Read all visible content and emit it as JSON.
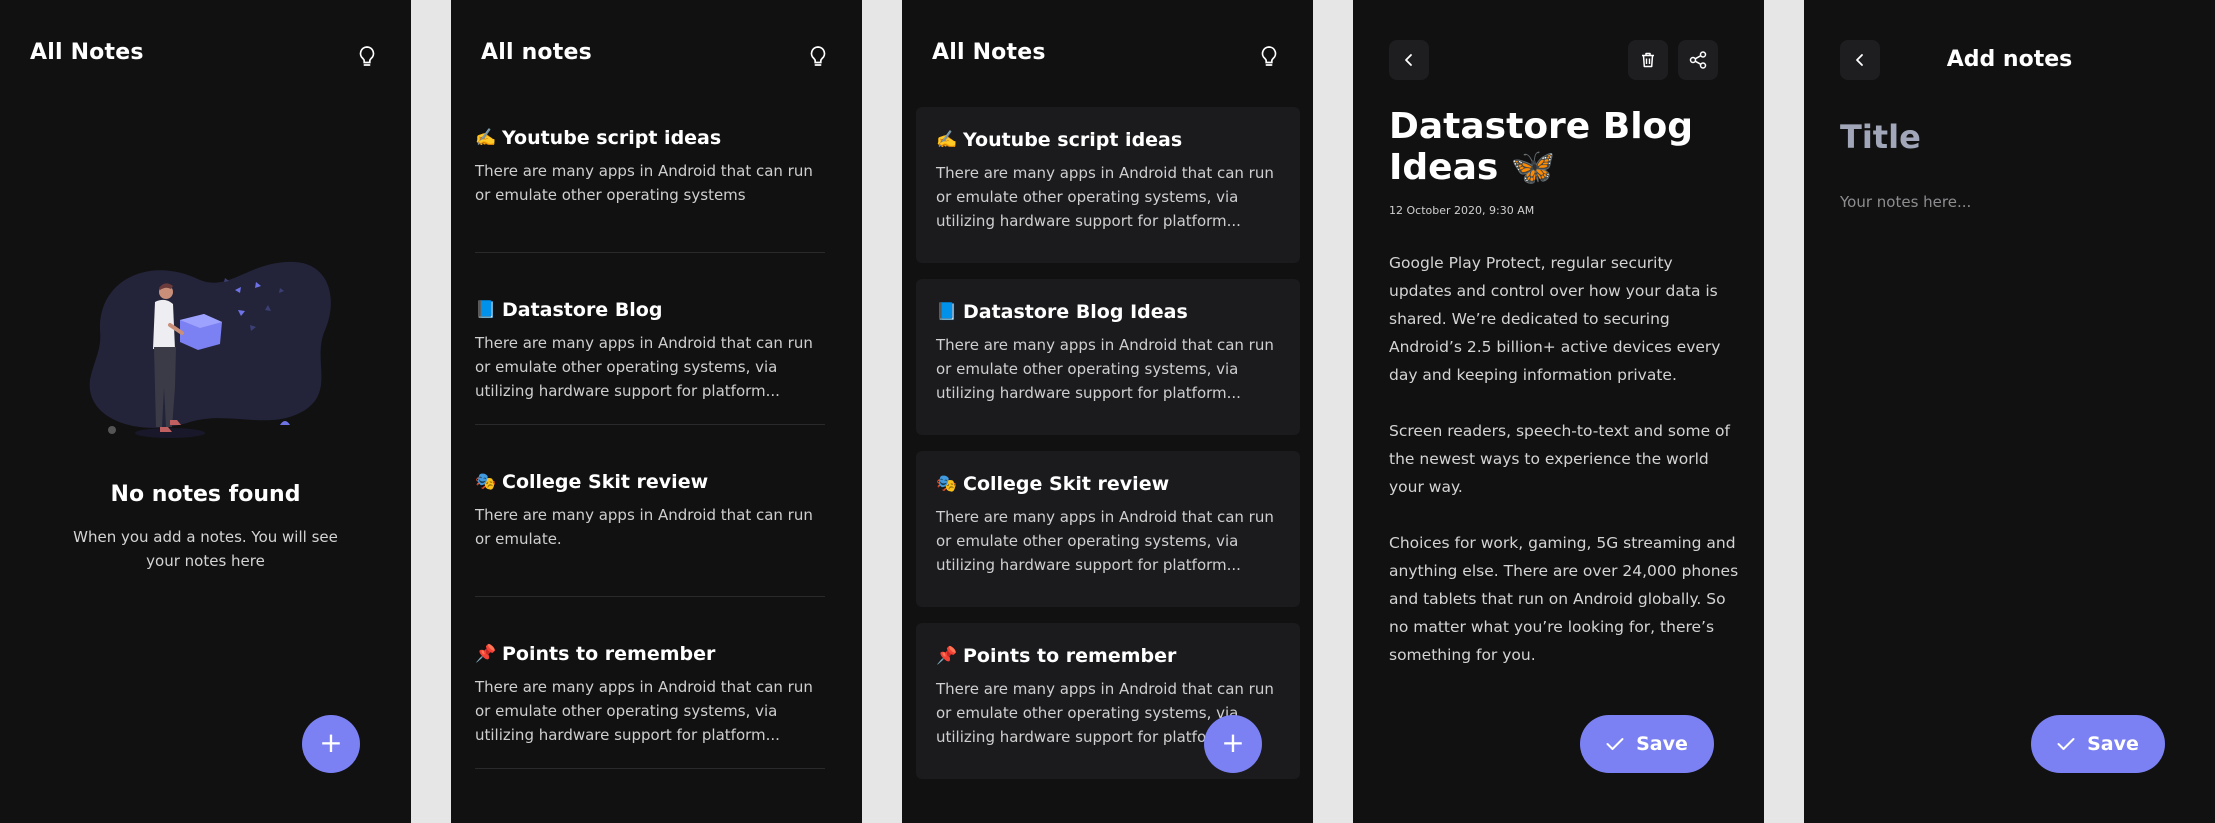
{
  "colors": {
    "accent": "#7b80f2",
    "screen_bg": "#111112",
    "card_bg": "#1b1b1e",
    "page_bg": "#e6e6e6"
  },
  "empty_screen": {
    "title": "All Notes",
    "empty_title": "No notes found",
    "empty_subtitle": "When you add a notes. You will see your notes here",
    "fab_label": "+",
    "icons": [
      "bulb-icon",
      "empty-illustration",
      "plus-icon"
    ]
  },
  "list_screen": {
    "title": "All notes",
    "notes": [
      {
        "emoji": "✍️",
        "icon": "writing-hand-icon",
        "title": "Youtube script ideas",
        "body": "There are many apps in Android that can run or emulate other operating systems"
      },
      {
        "emoji": "📘",
        "icon": "blue-book-icon",
        "title": "Datastore Blog",
        "body": "There are many apps in Android that can run or emulate other operating systems, via utilizing hardware support for platform..."
      },
      {
        "emoji": "🎭",
        "icon": "masks-icon",
        "title": "College Skit review",
        "body": "There are many apps in Android that can run or emulate."
      },
      {
        "emoji": "📌",
        "icon": "pushpin-icon",
        "title": "Points to remember",
        "body": "There are many apps in Android that can run or emulate other operating systems, via utilizing hardware support for platform..."
      }
    ]
  },
  "card_screen": {
    "title": "All Notes",
    "fab_label": "+",
    "notes": [
      {
        "emoji": "✍️",
        "icon": "writing-hand-icon",
        "title": "Youtube script ideas",
        "body": "There are many apps in Android that can run or emulate other operating systems, via utilizing hardware support for platform..."
      },
      {
        "emoji": "📘",
        "icon": "blue-book-icon",
        "title": "Datastore Blog Ideas",
        "body": "There are many apps in Android that can run or emulate other operating systems, via utilizing hardware support for platform..."
      },
      {
        "emoji": "🎭",
        "icon": "masks-icon",
        "title": "College Skit review",
        "body": "There are many apps in Android that can run or emulate other operating systems, via utilizing hardware support for platform..."
      },
      {
        "emoji": "📌",
        "icon": "pushpin-icon",
        "title": "Points to remember",
        "body": "There are many apps in Android that can run or emulate other operating systems, via utilizing hardware support for platform..."
      }
    ]
  },
  "detail_screen": {
    "title": "Datastore Blog Ideas 🦋",
    "date": "12 October 2020, 9:30 AM",
    "paragraphs": [
      "Google Play Protect, regular security updates and control over how your data is shared. We’re dedicated to securing Android’s 2.5 billion+ active devices every day and keeping information private.",
      "Screen readers, speech-to-text and some of the newest ways to experience the world your way.",
      "Choices for work, gaming, 5G streaming and anything else. There are over 24,000 phones and tablets that run on Android globally. So no matter what you’re looking for, there’s something for you."
    ],
    "save_label": "Save",
    "icons": [
      "back-arrow-icon",
      "trash-icon",
      "share-icon",
      "check-icon"
    ]
  },
  "add_screen": {
    "title": "Add notes",
    "title_placeholder": "Title",
    "notes_placeholder": "Your notes here...",
    "save_label": "Save",
    "icons": [
      "back-arrow-icon",
      "check-icon"
    ]
  }
}
